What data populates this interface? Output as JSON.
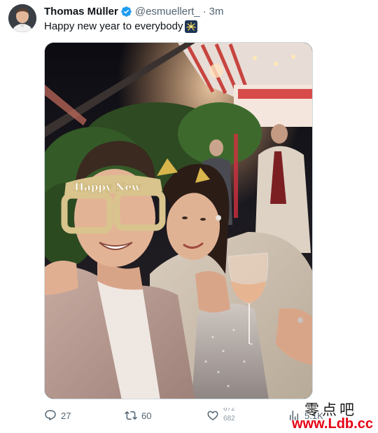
{
  "author": {
    "name": "Thomas Müller",
    "handle": "@esmuellert_",
    "separator": "·",
    "time": "3m",
    "verified_icon": "verified-badge-icon",
    "verified_color": "#1d9bf0"
  },
  "tweet": {
    "text": "Happy new year to everybody",
    "emoji": "fireworks-emoji-icon"
  },
  "media": {
    "glasses_text": "Happy New"
  },
  "actions": {
    "reply_count": "27",
    "retweet_count": "60",
    "like_count_top": "672",
    "like_count_bottom": "682",
    "views_count": "5.1K"
  },
  "watermark": {
    "chinese": "零点吧",
    "url": "www.Ldb.cc"
  },
  "colors": {
    "text_primary": "#0f1419",
    "text_secondary": "#536471",
    "watermark_red": "#e60012"
  }
}
